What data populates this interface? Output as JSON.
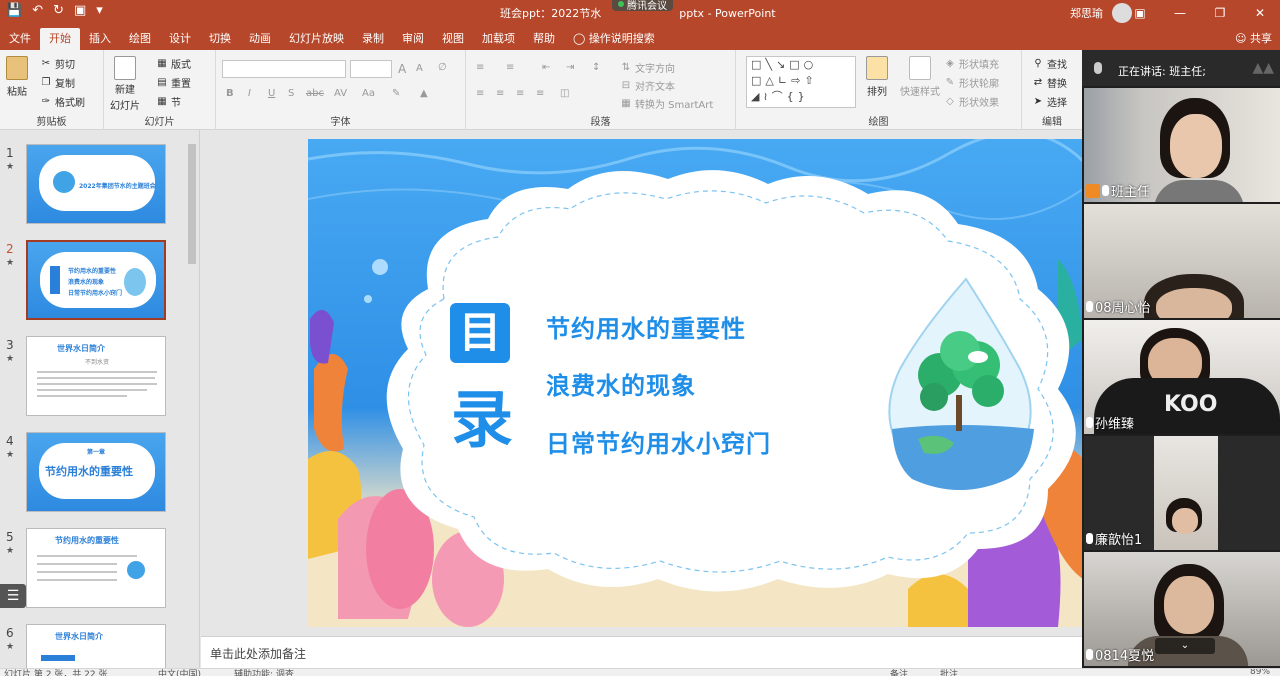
{
  "app": {
    "title": "班会ppt：2022节水",
    "title_tail": "pptx  -  PowerPoint",
    "user_name": "郑思瑜",
    "meeting_app": "腾讯会议"
  },
  "tabs": [
    "文件",
    "开始",
    "插入",
    "绘图",
    "设计",
    "切换",
    "动画",
    "幻灯片放映",
    "录制",
    "审阅",
    "视图",
    "加载项",
    "帮助"
  ],
  "tell_me": "操作说明搜索",
  "share": "共享",
  "ribbon": {
    "clipboard": {
      "label": "剪贴板",
      "paste": "粘贴",
      "cut": "剪切",
      "copy": "复制",
      "format_painter": "格式刷"
    },
    "slides": {
      "label": "幻灯片",
      "new_slide": "新建",
      "new_slide2": "幻灯片",
      "layout": "版式",
      "reset": "重置",
      "section": "节"
    },
    "font": {
      "label": "字体",
      "bold": "B",
      "italic": "I",
      "underline": "U",
      "shadow": "S",
      "strike": "abc",
      "spacing": "AV",
      "case": "Aa",
      "inc": "A",
      "dec": "A"
    },
    "paragraph": {
      "label": "段落",
      "text_direction": "文字方向",
      "align_text": "对齐文本",
      "smartart": "转换为 SmartArt"
    },
    "drawing": {
      "label": "绘图",
      "arrange": "排列",
      "quick_styles": "快速样式",
      "fill": "形状填充",
      "outline": "形状轮廓",
      "effects": "形状效果"
    },
    "editing": {
      "label": "编辑",
      "find": "查找",
      "replace": "替换",
      "select": "选择"
    }
  },
  "thumbnails": [
    {
      "num": "1",
      "title": "2022年集团节水的主题班会"
    },
    {
      "num": "2",
      "line1": "节约用水的重要性",
      "line2": "浪费水的现象",
      "line3": "日常节约用水小窍门"
    },
    {
      "num": "3",
      "title": "世界水日简介",
      "sub": "不到水资"
    },
    {
      "num": "4",
      "title": "节约用水的重要性",
      "sub": "第一章"
    },
    {
      "num": "5",
      "title": "节约用水的重要性"
    },
    {
      "num": "6",
      "title": "世界水日简介"
    }
  ],
  "slide": {
    "badge_top": "目",
    "badge_bottom": "录",
    "item1": "节约用水的重要性",
    "item2": "浪费水的现象",
    "item3": "日常节约用水小窍门"
  },
  "notes_placeholder": "单击此处添加备注",
  "status": {
    "left": "幻灯片 第 2 张，共 22 张",
    "lang": "中文(中国)",
    "assist": "辅助功能: 调查",
    "notes": "备注",
    "comments": "批注",
    "zoom": "89%"
  },
  "meeting": {
    "speaking": "正在讲话: 班主任;",
    "participants": [
      {
        "name": "班主任",
        "host": true
      },
      {
        "name": "08周心怡"
      },
      {
        "name": "孙维臻"
      },
      {
        "name": "廉歆怡1"
      },
      {
        "name": "0814夏悦"
      }
    ],
    "shirt_text": "KOO"
  },
  "colors": {
    "accent": "#b7472a",
    "slide_title": "#1f8ee8",
    "ribbon_bg": "#f3f3f3"
  }
}
